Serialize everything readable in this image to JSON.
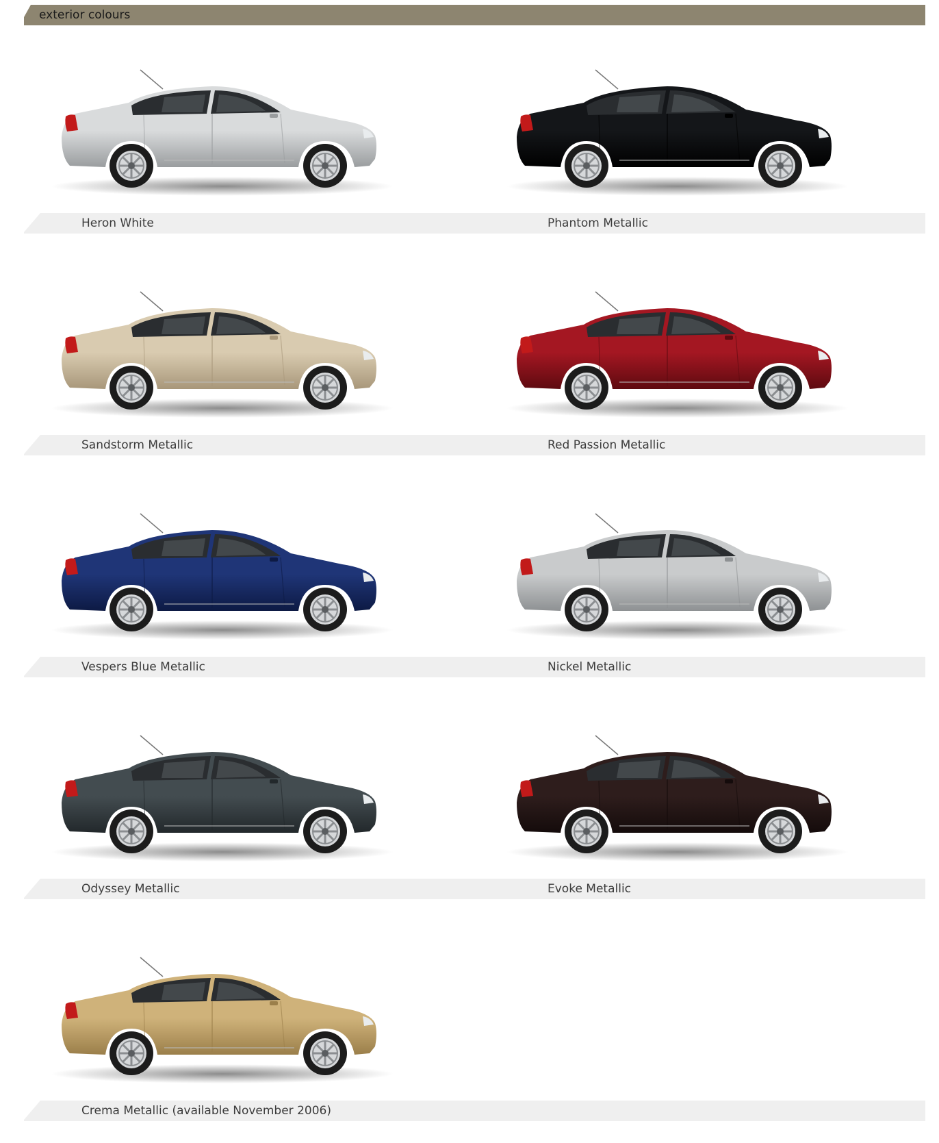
{
  "header": {
    "title": "exterior colours"
  },
  "colours": [
    {
      "name": "Heron White",
      "body": "#d9dbdc",
      "shade": "#9a9d9f"
    },
    {
      "name": "Phantom Metallic",
      "body": "#141619",
      "shade": "#000000"
    },
    {
      "name": "Sandstorm Metallic",
      "body": "#d9cbb0",
      "shade": "#a8977a"
    },
    {
      "name": "Red Passion Metallic",
      "body": "#a41722",
      "shade": "#5e0a10"
    },
    {
      "name": "Vespers Blue Metallic",
      "body": "#1f3577",
      "shade": "#0d1a44"
    },
    {
      "name": "Nickel Metallic",
      "body": "#c9cbcc",
      "shade": "#8e9193"
    },
    {
      "name": "Odyssey Metallic",
      "body": "#434c50",
      "shade": "#22282b"
    },
    {
      "name": "Evoke Metallic",
      "body": "#2e1d1c",
      "shade": "#140b0b"
    },
    {
      "name": "Crema Metallic (available November 2006)",
      "body": "#cfb27a",
      "shade": "#9b7f4a"
    }
  ]
}
